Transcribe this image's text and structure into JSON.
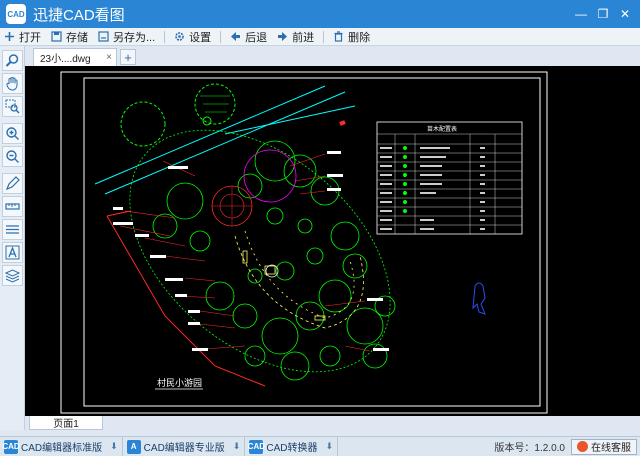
{
  "window": {
    "logo_text": "CAD",
    "title": "迅捷CAD看图",
    "minimize": "—",
    "restore": "❐",
    "close": "✕"
  },
  "toolbar": {
    "items": [
      {
        "label": "打开",
        "icon": "plus-icon"
      },
      {
        "label": "存储",
        "icon": "save-icon"
      },
      {
        "label": "另存为...",
        "icon": "save-as-icon"
      },
      {
        "label": "设置",
        "icon": "gear-icon"
      },
      {
        "label": "后退",
        "icon": "back-arrow-icon"
      },
      {
        "label": "前进",
        "icon": "forward-arrow-icon"
      },
      {
        "label": "删除",
        "icon": "trash-icon"
      }
    ]
  },
  "tools": [
    "magnifier-icon",
    "hand-pan-icon",
    "zoom-window-icon",
    "zoom-in-icon",
    "zoom-out-icon",
    "pen-icon",
    "measure-icon",
    "layers-icon",
    "text-icon",
    "stack-icon"
  ],
  "tabs": {
    "active": "23小....dwg",
    "close": "×",
    "new": "+"
  },
  "drawing": {
    "title_text": "村民小游园",
    "legend_title": "苗木配置表"
  },
  "layout_tabs": [
    "页面1"
  ],
  "statusbar": {
    "items": [
      {
        "logo": "CAD",
        "label": "CAD编辑器标准版"
      },
      {
        "logo": "A",
        "label": "CAD编辑器专业版"
      },
      {
        "logo": "CAD",
        "label": "CAD转换器"
      }
    ],
    "download_glyph": "⬇",
    "version": "版本号：1.2.0.0",
    "service": "在线客服"
  },
  "colors": {
    "accent": "#2a86d4",
    "cad_green": "#00ff00",
    "cad_red": "#ff2a2a",
    "cad_cyan": "#00ffff",
    "cad_yellow": "#ffff66",
    "cad_magenta": "#ff00ff",
    "cad_blue": "#2a4bff"
  }
}
